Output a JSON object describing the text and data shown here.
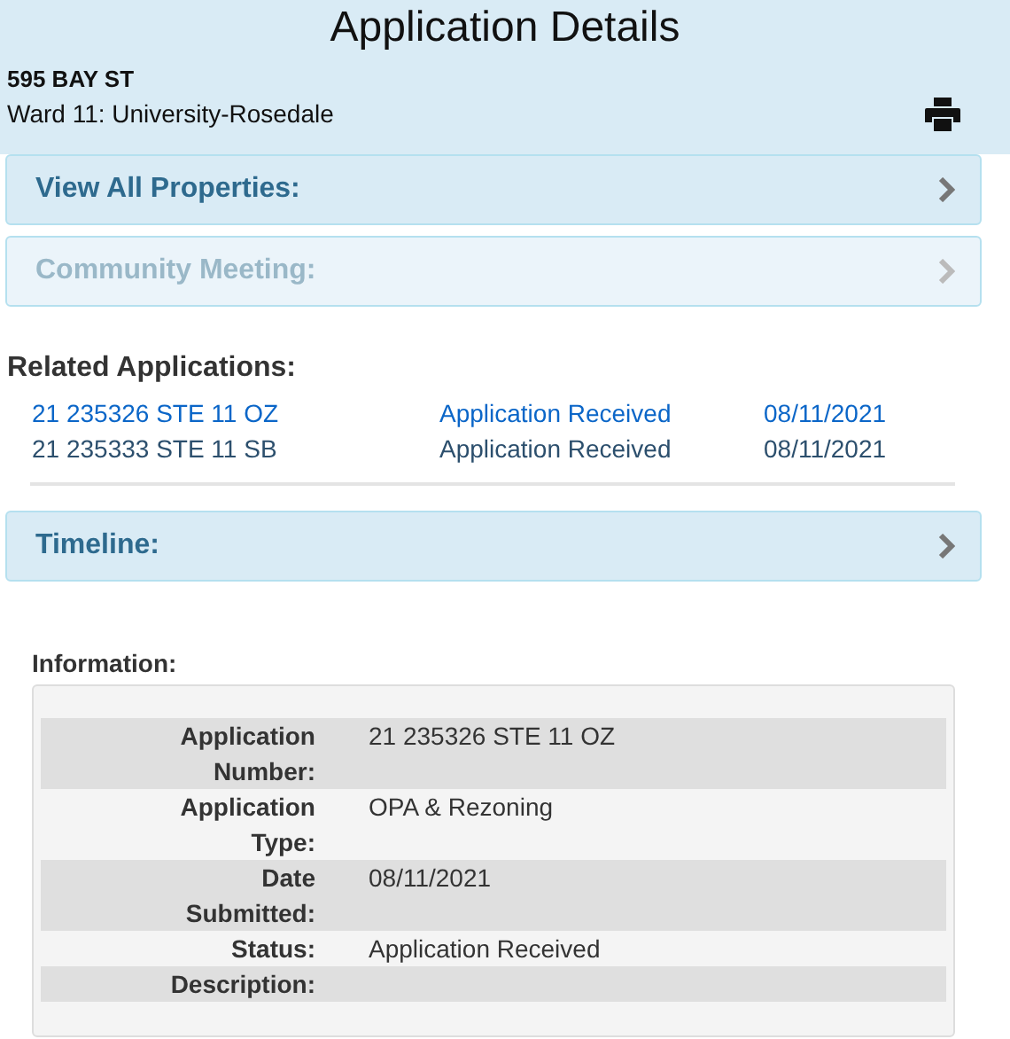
{
  "header": {
    "title": "Application Details",
    "address": "595 BAY ST",
    "ward": "Ward 11: University-Rosedale"
  },
  "panels_top": [
    {
      "label": "View All Properties:",
      "disabled": false
    },
    {
      "label": "Community Meeting:",
      "disabled": true
    }
  ],
  "related": {
    "heading": "Related Applications:",
    "rows": [
      {
        "number": "21 235326 STE 11 OZ",
        "status": "Application Received",
        "date": "08/11/2021",
        "selected": true
      },
      {
        "number": "21 235333 STE 11 SB",
        "status": "Application Received",
        "date": "08/11/2021",
        "selected": false
      }
    ]
  },
  "panels_bottom": [
    {
      "label": "Timeline:",
      "disabled": false
    }
  ],
  "information": {
    "heading": "Information:",
    "rows": [
      {
        "label": "Application Number:",
        "value": "21 235326 STE 11 OZ"
      },
      {
        "label": "Application Type:",
        "value": "OPA & Rezoning"
      },
      {
        "label": "Date Submitted:",
        "value": "08/11/2021"
      },
      {
        "label": "Status:",
        "value": "Application Received"
      },
      {
        "label": "Description:"
      }
    ]
  }
}
